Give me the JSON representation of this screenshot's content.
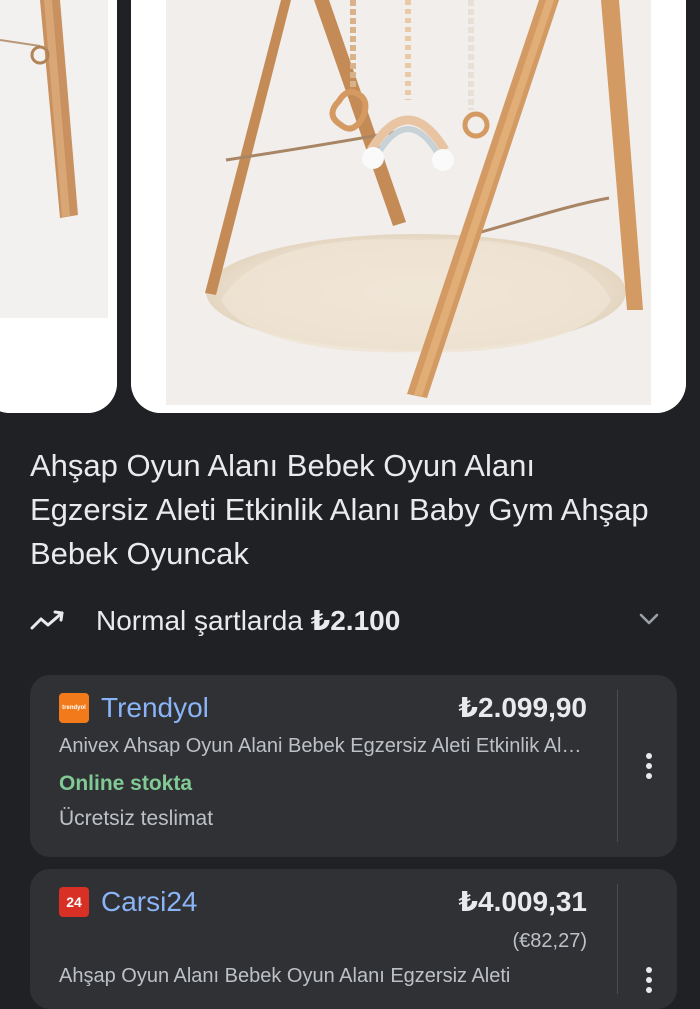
{
  "product": {
    "title": "Ahşap Oyun Alanı Bebek Oyun Alanı Egzersiz Aleti Etkinlik Alanı Baby Gym Ahşap Bebek Oyuncak",
    "price_prefix": "Normal şartlarda",
    "typical_price": "₺2.100"
  },
  "offers": [
    {
      "store": "Trendyol",
      "logo_text": "trendyol",
      "price": "₺2.099,90",
      "description": "Anivex Ahsap Oyun Alani Bebek Egzersiz Aleti Etkinlik Alani Baby Gym",
      "stock": "Online stokta",
      "shipping": "Ücretsiz teslimat"
    },
    {
      "store": "Carsi24",
      "logo_text": "24",
      "price": "₺4.009,31",
      "secondary_price": "(€82,27)",
      "description": "Ahşap Oyun Alanı Bebek Oyun Alanı Egzersiz Aleti"
    }
  ],
  "colors": {
    "background": "#202124",
    "card": "#303134",
    "link": "#8ab4f8",
    "in_stock": "#81c995",
    "trendyol_logo": "#f27a1a",
    "carsi24_logo": "#d93025"
  }
}
